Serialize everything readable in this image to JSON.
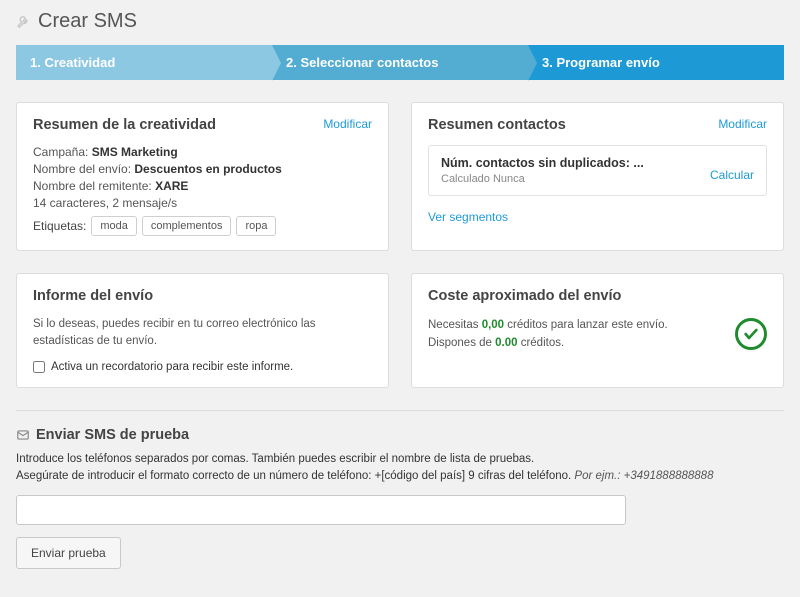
{
  "page": {
    "title": "Crear SMS"
  },
  "steps": {
    "s1": "1. Creatividad",
    "s2": "2. Seleccionar contactos",
    "s3": "3. Programar envío"
  },
  "creativity": {
    "title": "Resumen de la creatividad",
    "modify": "Modificar",
    "campaign_label": "Campaña: ",
    "campaign_value": "SMS Marketing",
    "sendname_label": "Nombre del envío: ",
    "sendname_value": "Descuentos en productos",
    "sender_label": "Nombre del remitente: ",
    "sender_value": "XARE",
    "charinfo": "14 caracteres, 2 mensaje/s",
    "tags_label": "Etiquetas:",
    "tags": [
      "moda",
      "complementos",
      "ropa"
    ]
  },
  "contacts": {
    "title": "Resumen contactos",
    "modify": "Modificar",
    "box_title": "Núm. contactos sin duplicados: ...",
    "box_sub": "Calculado Nunca",
    "calc": "Calcular",
    "segments": "Ver segmentos"
  },
  "report": {
    "title": "Informe del envío",
    "desc": "Si lo deseas, puedes recibir en tu correo electrónico las estadísticas de tu envío.",
    "checkbox_label": "Activa un recordatorio para recibir este informe."
  },
  "cost": {
    "title": "Coste aproximado del envío",
    "need_pre": "Necesitas ",
    "need_val": "0,00",
    "need_post": " créditos para lanzar este envío.",
    "have_pre": "Dispones de ",
    "have_val": "0.00",
    "have_post": " créditos."
  },
  "test": {
    "title": "Enviar SMS de prueba",
    "desc1": "Introduce los teléfonos separados por comas. También puedes escribir el nombre de lista de pruebas.",
    "desc2a": "Asegúrate de introducir el formato correcto de un número de teléfono: +[código del país] 9 cifras del teléfono. ",
    "desc2b": "Por ejm.: +3491888888888",
    "placeholder": "",
    "button": "Enviar prueba"
  }
}
